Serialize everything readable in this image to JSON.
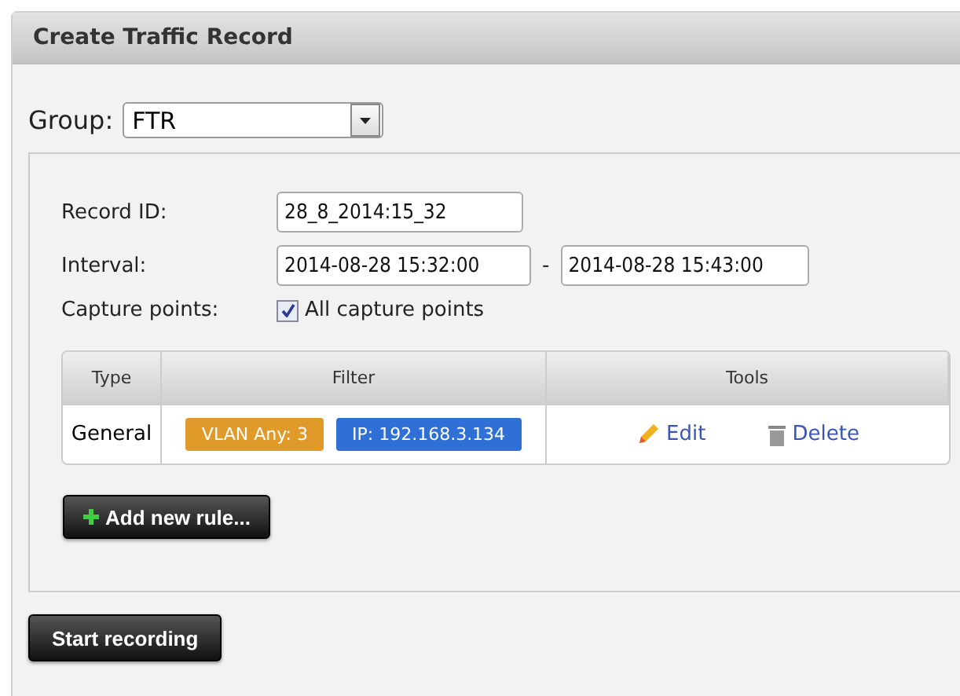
{
  "panel": {
    "title": "Create Traffic Record"
  },
  "group": {
    "label": "Group:",
    "value": "FTR"
  },
  "form": {
    "record_id": {
      "label": "Record ID:",
      "value": "28_8_2014:15_32"
    },
    "interval": {
      "label": "Interval:",
      "from": "2014-08-28 15:32:00",
      "separator": "-",
      "to": "2014-08-28 15:43:00"
    },
    "capture_points": {
      "label": "Capture points:",
      "option": "All capture points",
      "checked": true
    }
  },
  "table": {
    "columns": [
      "Type",
      "Filter",
      "Tools"
    ],
    "rows": [
      {
        "type": "General",
        "filters": [
          {
            "text": "VLAN Any: 3",
            "color": "#e09a2a"
          },
          {
            "text": "IP: 192.168.3.134",
            "color": "#2f6fd6"
          }
        ],
        "tools": [
          {
            "kind": "edit",
            "label": "Edit"
          },
          {
            "kind": "delete",
            "label": "Delete"
          }
        ]
      }
    ]
  },
  "add_button": "Add new rule...",
  "start_button": "Start recording"
}
